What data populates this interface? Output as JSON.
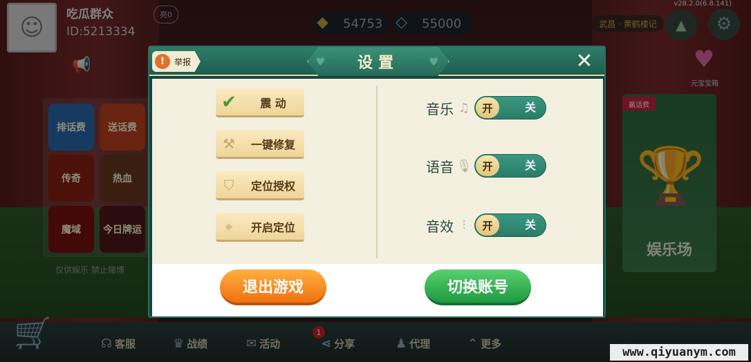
{
  "user": {
    "name": "吃瓜群众",
    "id_text": "ID:5213334",
    "badge": "亮0"
  },
  "currency": {
    "gold": "54753",
    "diamond": "55000"
  },
  "version": "v28.2.0(6.8.141)",
  "top_right": {
    "notice": "武昌 · 黄鹤楼记",
    "treasure_label": "元宝宝箱"
  },
  "lobby": {
    "games": [
      "排话费",
      "送话费",
      "传奇",
      "热血",
      "魔域",
      "今日牌运"
    ],
    "disclaimer": "仅供娱乐  禁止赌博",
    "promo_tag": "赢话费",
    "promo_label": "娱乐场"
  },
  "bottom_nav": {
    "items": [
      {
        "label": "客服",
        "icon": "headset-icon"
      },
      {
        "label": "战绩",
        "icon": "trophy-icon"
      },
      {
        "label": "活动",
        "icon": "gift-icon"
      },
      {
        "label": "分享",
        "icon": "share-icon",
        "badge": "1"
      },
      {
        "label": "代理",
        "icon": "agent-icon"
      },
      {
        "label": "更多",
        "icon": "more-icon"
      }
    ]
  },
  "watermark": "www.qiyuanym.com",
  "dialog": {
    "title": "设置",
    "report_label": "举报",
    "close_glyph": "✕",
    "left_options": [
      {
        "label": "震 动",
        "icon": "checkbox-checked-icon",
        "checked": true
      },
      {
        "label": "一键修复",
        "icon": "wrench-icon"
      },
      {
        "label": "定位授权",
        "icon": "shield-location-icon"
      },
      {
        "label": "开启定位",
        "icon": "location-pin-icon"
      }
    ],
    "settings": [
      {
        "label": "音乐",
        "icon": "music-note-icon",
        "on_label": "开",
        "off_label": "关"
      },
      {
        "label": "语音",
        "icon": "microphone-icon",
        "on_label": "开",
        "off_label": "关"
      },
      {
        "label": "音效",
        "icon": "equalizer-icon",
        "on_label": "开",
        "off_label": "关"
      }
    ],
    "buttons": {
      "quit": "退出游戏",
      "switch_account": "切换账号"
    }
  },
  "colors": {
    "dialog_header": "#1d5c4e",
    "quit_button": "#f07010",
    "switch_button": "#1e9a40",
    "toggle_track": "#2a7c68"
  }
}
